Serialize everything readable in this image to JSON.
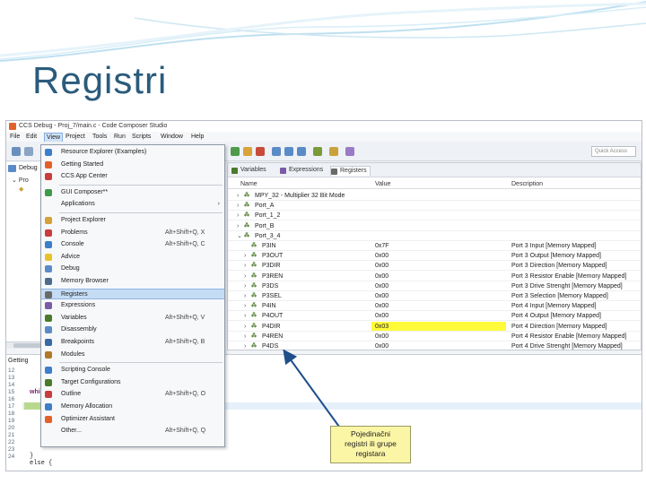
{
  "slide": {
    "title": "Registri"
  },
  "window": {
    "title": "CCS Debug - Proj_7/main.c - Code Composer Studio"
  },
  "menubar": {
    "items": [
      "File",
      "Edit",
      "View",
      "Project",
      "Tools",
      "Run",
      "Scripts",
      "Window",
      "Help"
    ]
  },
  "toolbar": {
    "quick_access_placeholder": "Quick Access"
  },
  "left_pane": {
    "debug_tab": "Debug",
    "tree_item": "Pro"
  },
  "view_menu": {
    "items": [
      {
        "label": "Resource Explorer (Examples)",
        "shortcut": "",
        "color": "#3d7fc9"
      },
      {
        "label": "Getting Started",
        "shortcut": "",
        "color": "#e2612a"
      },
      {
        "label": "CCS App Center",
        "shortcut": "",
        "color": "#c93d3d"
      },
      {
        "label": "GUI Composer**",
        "shortcut": "",
        "color": "#3f9a4a"
      },
      {
        "label": "Applications",
        "shortcut": "",
        "arrow": "›",
        "color": ""
      },
      {
        "label": "Project Explorer",
        "shortcut": "",
        "color": "#d4a23a"
      },
      {
        "label": "Problems",
        "shortcut": "Alt+Shift+Q, X",
        "color": "#c93d3d"
      },
      {
        "label": "Console",
        "shortcut": "Alt+Shift+Q, C",
        "color": "#3d7fc9"
      },
      {
        "label": "Advice",
        "shortcut": "",
        "color": "#e8c22a"
      },
      {
        "label": "Debug",
        "shortcut": "",
        "color": "#5b8bc6"
      },
      {
        "label": "Memory Browser",
        "shortcut": "",
        "color": "#4f6b8c"
      },
      {
        "label": "Registers",
        "shortcut": "",
        "color": "#6a6a6a"
      },
      {
        "label": "Expressions",
        "shortcut": "",
        "color": "#7a5ba6"
      },
      {
        "label": "Variables",
        "shortcut": "Alt+Shift+Q, V",
        "color": "#4a7a2a"
      },
      {
        "label": "Disassembly",
        "shortcut": "",
        "color": "#5b8bc6"
      },
      {
        "label": "Breakpoints",
        "shortcut": "Alt+Shift+Q, B",
        "color": "#3a6aa6"
      },
      {
        "label": "Modules",
        "shortcut": "",
        "color": "#b07a2a"
      },
      {
        "label": "Scripting Console",
        "shortcut": "",
        "color": "#3d7fc9"
      },
      {
        "label": "Target Configurations",
        "shortcut": "",
        "color": "#4a7a2a"
      },
      {
        "label": "Outline",
        "shortcut": "Alt+Shift+Q, O",
        "color": "#c93d3d"
      },
      {
        "label": "Memory Allocation",
        "shortcut": "",
        "color": "#3d7fc9"
      },
      {
        "label": "Optimizer Assistant",
        "shortcut": "",
        "color": "#e2612a"
      },
      {
        "label": "Other...",
        "shortcut": "Alt+Shift+Q, Q",
        "color": ""
      }
    ],
    "selected_index": 11
  },
  "register_view": {
    "tabs": [
      {
        "label": "Variables",
        "color": "#4a7a2a"
      },
      {
        "label": "Expressions",
        "color": "#7a5ba6"
      },
      {
        "label": "Registers",
        "color": "#6a6a6a",
        "active": true
      }
    ],
    "columns": [
      "Name",
      "Value",
      "Description"
    ],
    "rows": [
      {
        "expander": "›",
        "name": "MPY_32 - Multiplier 32 Bit Mode",
        "value": "",
        "description": ""
      },
      {
        "expander": "›",
        "name": "Port_A",
        "value": "",
        "description": ""
      },
      {
        "expander": "›",
        "name": "Port_1_2",
        "value": "",
        "description": ""
      },
      {
        "expander": "›",
        "name": "Port_B",
        "value": "",
        "description": ""
      },
      {
        "expander": "⌄",
        "name": "Port_3_4",
        "value": "",
        "description": ""
      },
      {
        "expander": "",
        "name": "P3IN",
        "value": "0x7F",
        "description": "Port 3 Input [Memory Mapped]"
      },
      {
        "expander": "›",
        "name": "P3OUT",
        "value": "0x00",
        "description": "Port 3 Output [Memory Mapped]"
      },
      {
        "expander": "›",
        "name": "P3DIR",
        "value": "0x00",
        "description": "Port 3 Direction [Memory Mapped]"
      },
      {
        "expander": "›",
        "name": "P3REN",
        "value": "0x00",
        "description": "Port 3 Resistor Enable [Memory Mapped]"
      },
      {
        "expander": "›",
        "name": "P3DS",
        "value": "0x00",
        "description": "Port 3 Drive Strenght [Memory Mapped]"
      },
      {
        "expander": "›",
        "name": "P3SEL",
        "value": "0x00",
        "description": "Port 3 Selection [Memory Mapped]"
      },
      {
        "expander": "›",
        "name": "P4IN",
        "value": "0x00",
        "description": "Port 4 Input [Memory Mapped]"
      },
      {
        "expander": "›",
        "name": "P4OUT",
        "value": "0x00",
        "description": "Port 4 Output [Memory Mapped]"
      },
      {
        "expander": "›",
        "name": "P4DIR",
        "value": "0x03",
        "description": "Port 4 Direction [Memory Mapped]",
        "highlight": true
      },
      {
        "expander": "›",
        "name": "P4REN",
        "value": "0x00",
        "description": "Port 4 Resistor Enable [Memory Mapped]"
      },
      {
        "expander": "›",
        "name": "P4DS",
        "value": "0x00",
        "description": "Port 4 Drive Strenght [Memory Mapped]"
      }
    ]
  },
  "editor": {
    "tab": "Getting",
    "line_numbers": [
      "12",
      "13",
      "14",
      "15",
      "16",
      "17",
      "18",
      "19",
      "20",
      "21",
      "22",
      "23",
      "24"
    ],
    "keyword": "whi",
    "lines": [
      "}",
      "else {"
    ]
  },
  "callout": {
    "lines": [
      "Pojedinačni",
      "registri ili grupe",
      "registara"
    ]
  },
  "colors": {
    "title": "#2a5b7c",
    "callout_fill": "#fbf6a6",
    "arrow": "#1f4f8a",
    "value_highlight": "#fffb3a",
    "menu_selected": "#c5dcf5"
  }
}
